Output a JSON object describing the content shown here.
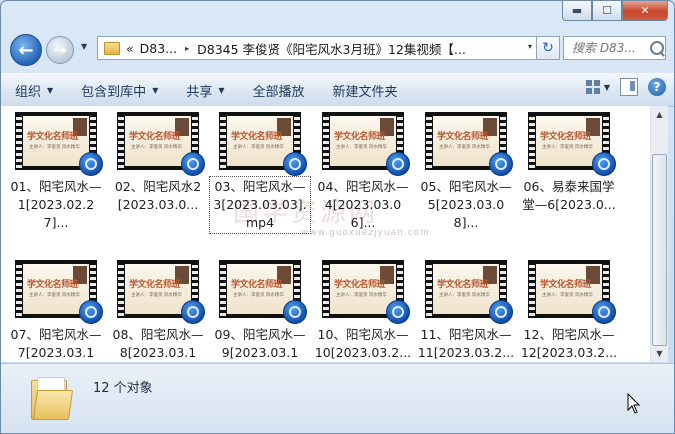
{
  "window": {
    "caption_buttons": {
      "minimize": "▬",
      "maximize": "☐",
      "close": "✕"
    }
  },
  "nav": {
    "back_glyph": "←",
    "forward_glyph": "→",
    "dropdown_glyph": "▼",
    "address": {
      "prefix": "«",
      "crumb1": "D83...",
      "separator": "▸",
      "crumb2": "D8345 李俊贤《阳宅风水3月班》12集视频【...",
      "dropdown": "▾"
    },
    "refresh_glyph": "↻",
    "search_placeholder": "搜索 D83..."
  },
  "toolbar": {
    "items": [
      {
        "label": "组织",
        "caret": "▼"
      },
      {
        "label": "包含到库中",
        "caret": "▼"
      },
      {
        "label": "共享",
        "caret": "▼"
      },
      {
        "label": "全部播放",
        "caret": ""
      },
      {
        "label": "新建文件夹",
        "caret": ""
      }
    ],
    "view_caret": "▼",
    "help_label": "?"
  },
  "thumbnail": {
    "title": "学文化名师班",
    "subtitle": "主讲人：李俊贤   风水精华"
  },
  "files": [
    {
      "label": "01、阳宅风水—1[2023.02.27]..."
    },
    {
      "label": "02、阳宅风水2[2023.03.0..."
    },
    {
      "label": "03、阳宅风水—3[2023.03.03].mp4"
    },
    {
      "label": "04、阳宅风水—4[2023.03.06]..."
    },
    {
      "label": "05、阳宅风水—5[2023.03.08]..."
    },
    {
      "label": "06、易泰来国学堂—6[2023.0..."
    },
    {
      "label": "07、阳宅风水—7[2023.03.13]..."
    },
    {
      "label": "08、阳宅风水—8[2023.03.15]..."
    },
    {
      "label": "09、阳宅风水—9[2023.03.17]..."
    },
    {
      "label": "10、阳宅风水—10[2023.03.2..."
    },
    {
      "label": "11、阳宅风水—11[2023.03.2..."
    },
    {
      "label": "12、阳宅风水—12[2023.03.2..."
    }
  ],
  "watermark": {
    "text": "国学资源网",
    "url": "www.guoxuezjyuan.com"
  },
  "scrollbar": {
    "up": "▲",
    "down": "▼"
  },
  "status": {
    "count_text": "12 个对象"
  }
}
